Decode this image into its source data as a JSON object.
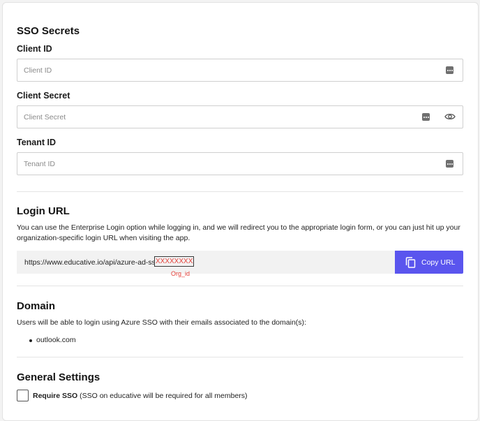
{
  "sso_secrets": {
    "title": "SSO Secrets",
    "client_id": {
      "label": "Client ID",
      "placeholder": "Client ID",
      "value": ""
    },
    "client_secret": {
      "label": "Client Secret",
      "placeholder": "Client Secret",
      "value": ""
    },
    "tenant_id": {
      "label": "Tenant ID",
      "placeholder": "Tenant ID",
      "value": ""
    }
  },
  "login_url": {
    "title": "Login URL",
    "description_line1": "You can use the Enterprise Login option while logging in, and we will redirect you to the appropriate login form, or you can just hit up your",
    "description_line2": "organization-specific login URL when visiting the app.",
    "url_prefix": "https://www.educative.io/api/azure-ad-sso/",
    "org_placeholder": "XXXXXXXXX",
    "org_hint": "Org_id",
    "copy_label": "Copy URL"
  },
  "domain": {
    "title": "Domain",
    "description": "Users will be able to login using Azure SSO with their emails associated to the domain(s):",
    "domains": [
      "outlook.com"
    ]
  },
  "general_settings": {
    "title": "General Settings",
    "require_sso_label": "Require SSO",
    "require_sso_note": "(SSO on educative will be required for all members)",
    "require_sso_checked": false
  },
  "colors": {
    "accent": "#5a55ee",
    "hint_red": "#e5413a",
    "icon_gray": "#6f6f6f"
  },
  "icons": [
    "password-manager-icon",
    "eye-icon",
    "copy-icon"
  ]
}
